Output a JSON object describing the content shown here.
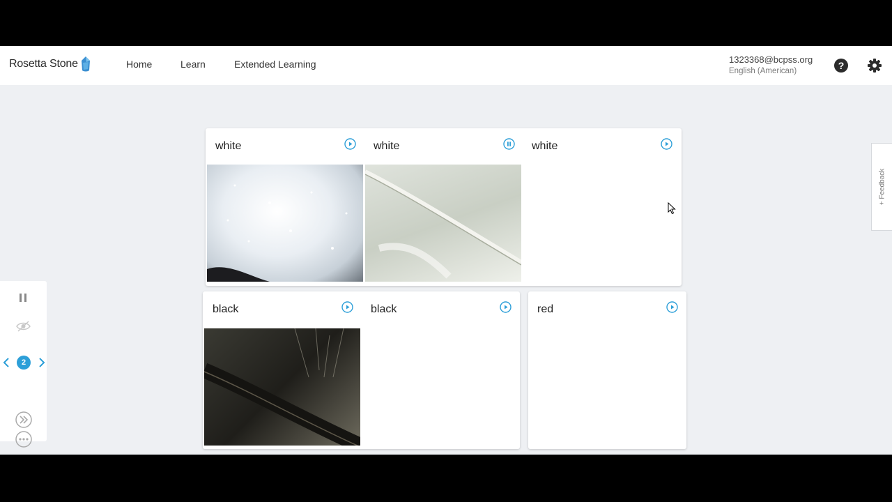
{
  "header": {
    "logo_text": "Rosetta Stone",
    "nav": [
      "Home",
      "Learn",
      "Extended Learning"
    ],
    "user_email": "1323368@bcpss.org",
    "user_language": "English (American)",
    "help_icon": "help-circle-icon",
    "settings_icon": "gear-icon"
  },
  "cards": [
    {
      "tiles": [
        {
          "word": "white",
          "audio_state": "play",
          "image": "white sugar crystals"
        },
        {
          "word": "white",
          "audio_state": "pause",
          "image": "white feather close-up"
        },
        {
          "word": "white",
          "audio_state": "play",
          "image": ""
        }
      ]
    },
    {
      "tiles": [
        {
          "word": "black",
          "audio_state": "play",
          "image": "black feather close-up"
        },
        {
          "word": "black",
          "audio_state": "play",
          "image": ""
        }
      ]
    },
    {
      "tiles": [
        {
          "word": "red",
          "audio_state": "play",
          "image": ""
        }
      ]
    }
  ],
  "side_panel": {
    "page_number": "2",
    "icons": [
      "pause-icon",
      "hide-eye-icon",
      "chevron-left-icon",
      "chevron-right-icon",
      "more-dots-icon",
      "skip-forward-icon"
    ]
  },
  "feedback": {
    "label": "+ Feedback"
  },
  "colors": {
    "accent": "#2d9fd8",
    "background": "#eef0f3",
    "header": "#ffffff"
  }
}
